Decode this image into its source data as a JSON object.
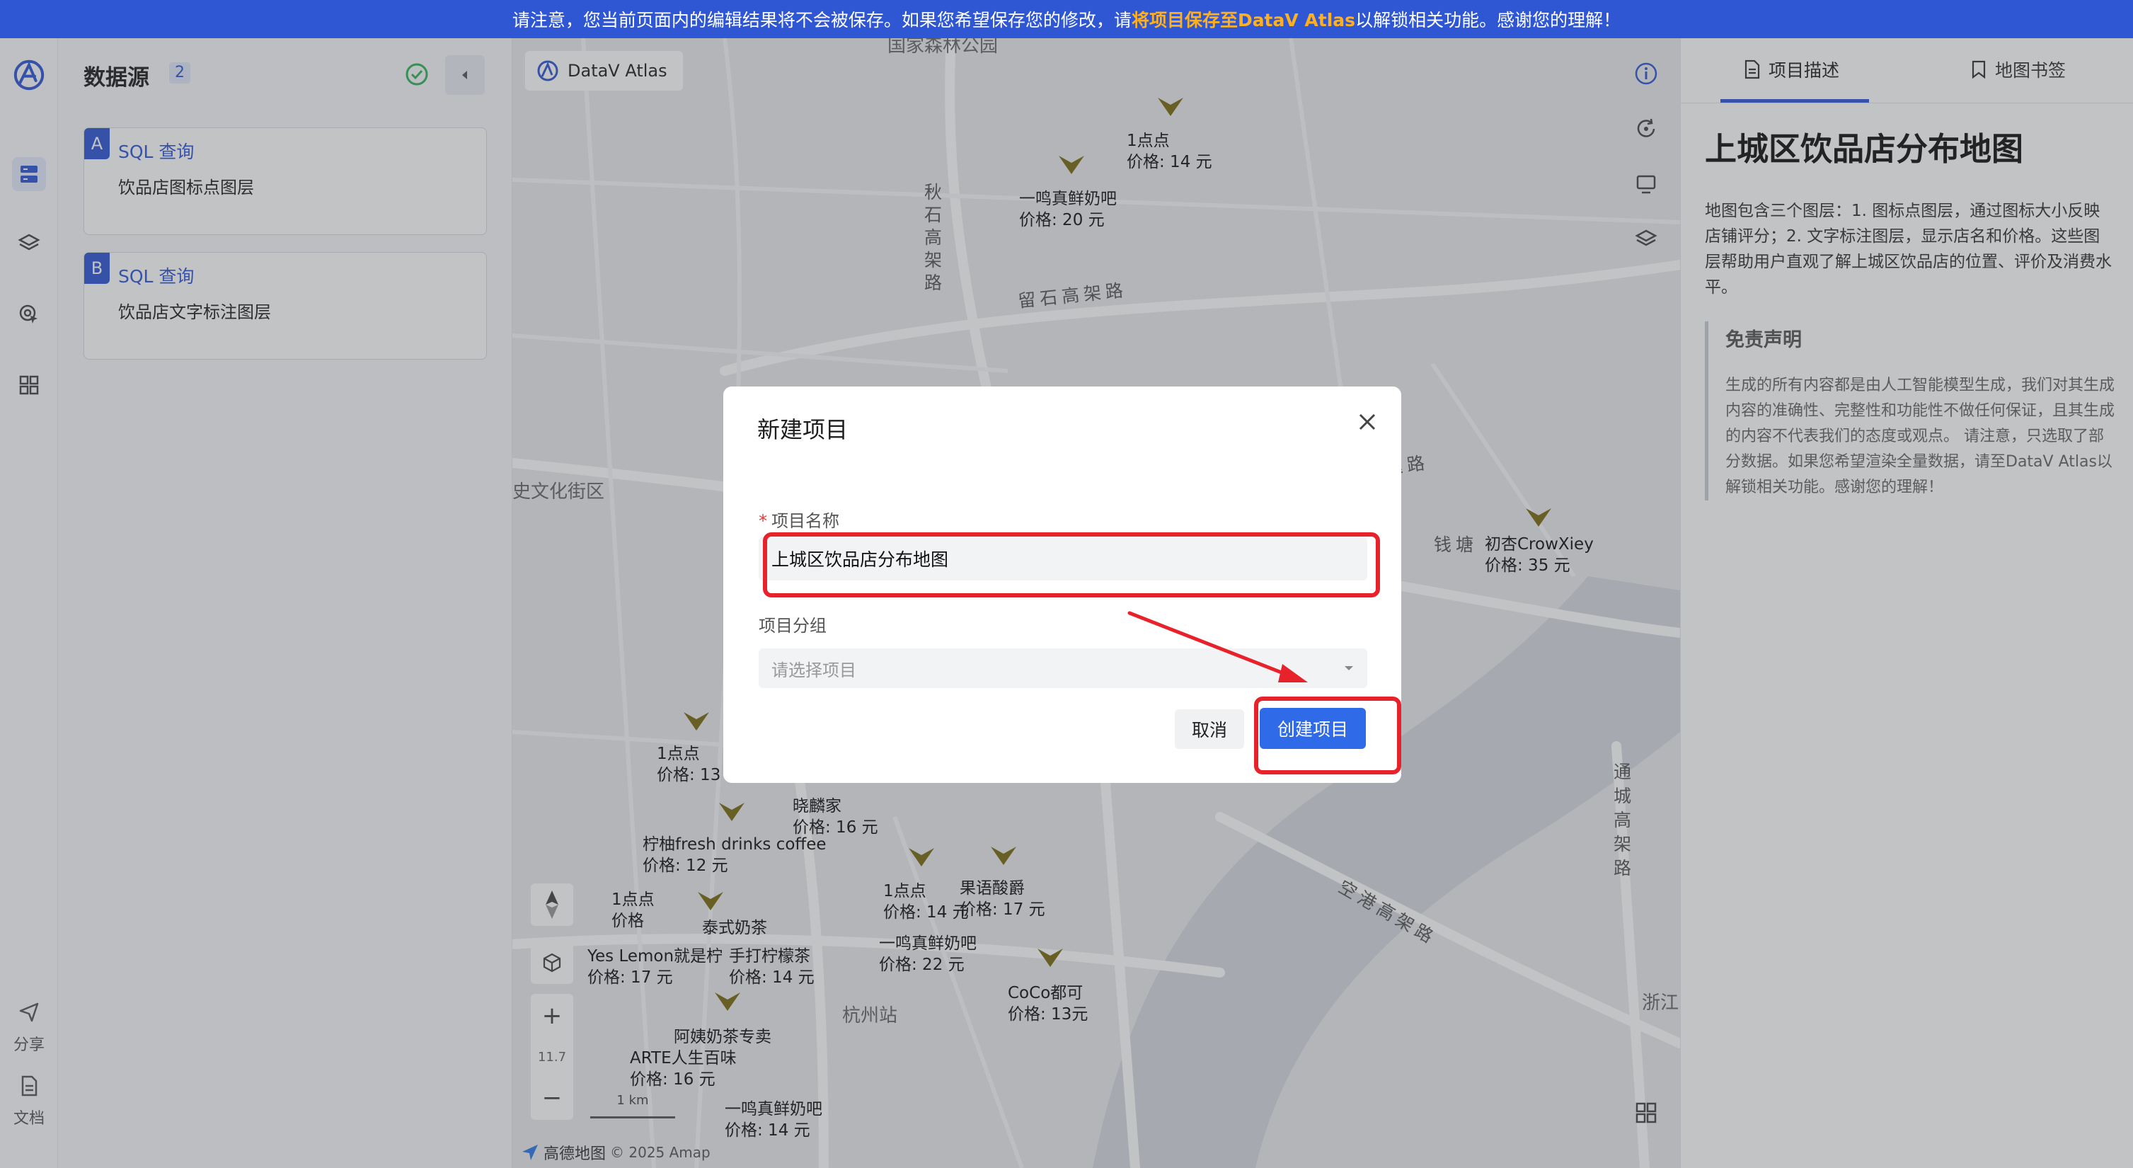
{
  "banner": {
    "prefix": "请注意，您当前页面内的编辑结果将不会被保存。如果您希望保存您的修改，请",
    "link": "将项目保存至DataV Atlas",
    "suffix": "以解锁相关功能。感谢您的理解！"
  },
  "rail": {
    "share_label": "分享",
    "docs_label": "文档"
  },
  "datasource": {
    "title": "数据源",
    "count": "2",
    "items": [
      {
        "letter": "A",
        "type": "SQL 查询",
        "name": "饮品店图标点图层"
      },
      {
        "letter": "B",
        "type": "SQL 查询",
        "name": "饮品店文字标注图层"
      }
    ]
  },
  "map": {
    "brand": "DataV Atlas",
    "zoom_level": "11.7",
    "scale": "1 km",
    "copyright": "© 2025 Amap",
    "amap_label": "高德地图",
    "areas": [
      {
        "text": "国家森林公园"
      },
      {
        "text": "史文化街区"
      },
      {
        "text": "杭州站"
      },
      {
        "text": "浙江"
      }
    ],
    "roads": [
      {
        "text": "秋石高架路"
      },
      {
        "text": "留石高架路"
      },
      {
        "text": "钱塘"
      },
      {
        "text": "快速路"
      },
      {
        "text": "通城高架路"
      },
      {
        "text": "空港高架路"
      }
    ],
    "pois": [
      {
        "name": "1点点",
        "price": "价格: 14 元"
      },
      {
        "name": "一鸣真鲜奶吧",
        "price": "价格: 20 元"
      },
      {
        "name": "初杏CrowXiey",
        "price": "价格: 35 元"
      },
      {
        "name": "1点点",
        "price": "价格: 13"
      },
      {
        "name": "晓麟家",
        "price": "价格: 16 元"
      },
      {
        "name": "柠柚fresh drinks coffee",
        "price": "价格: 12 元"
      },
      {
        "name": "1点点",
        "price": "价格: 14 元"
      },
      {
        "name": "果语酸爵",
        "price": "价格: 17 元"
      },
      {
        "name": "一鸣真鲜奶吧",
        "price": "价格: 22 元"
      },
      {
        "name": "1点点",
        "price": "价格"
      },
      {
        "name": "泰式奶茶",
        "price": ""
      },
      {
        "name": "Yes Lemon就是柠",
        "price": "价格: 17 元"
      },
      {
        "name": "手打柠檬茶",
        "price": "价格: 14 元"
      },
      {
        "name": "CoCo都可",
        "price": "价格: 13元"
      },
      {
        "name": "阿姨奶茶专卖",
        "price": ""
      },
      {
        "name": "ARTE人生百味",
        "price": "价格: 16 元"
      },
      {
        "name": "一鸣真鲜奶吧",
        "price": "价格: 14 元"
      }
    ]
  },
  "side": {
    "tab_desc": "项目描述",
    "tab_bookmark": "地图书签",
    "title": "上城区饮品店分布地图",
    "desc": "地图包含三个图层：1. 图标点图层，通过图标大小反映店铺评分；2. 文字标注图层，显示店名和价格。这些图层帮助用户直观了解上城区饮品店的位置、评价及消费水平。",
    "disclaimer_title": "免责声明",
    "disclaimer_text": "生成的所有内容都是由人工智能模型生成，我们对其生成内容的准确性、完整性和功能性不做任何保证，且其生成的内容不代表我们的态度或观点。 请注意，只选取了部分数据。如果您希望渲染全量数据，请至DataV Atlas以解锁相关功能。感谢您的理解！"
  },
  "modal": {
    "title": "新建项目",
    "required_mark": "*",
    "name_label": "项目名称",
    "name_value": "上城区饮品店分布地图",
    "group_label": "项目分组",
    "group_placeholder": "请选择项目",
    "cancel": "取消",
    "create": "创建项目"
  },
  "colors": {
    "accent": "#2f57d4",
    "create_button": "#2f6ae8",
    "highlight": "#e8222a"
  }
}
